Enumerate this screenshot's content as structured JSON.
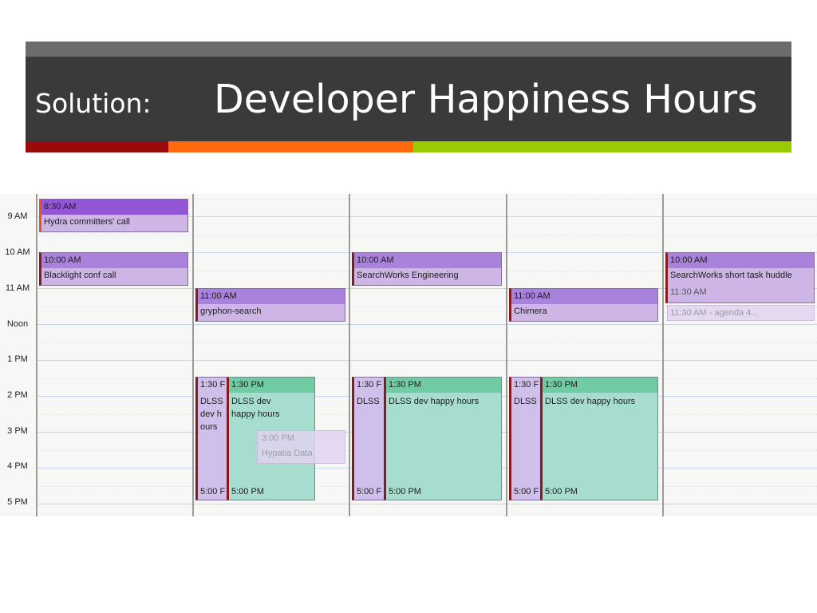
{
  "slide": {
    "prefix": "Solution:",
    "title": "Developer Happiness Hours",
    "stripe_colors": [
      "#9a0a0a",
      "#ff6a0c",
      "#99cc00"
    ]
  },
  "calendar": {
    "time_labels": [
      "9 AM",
      "10 AM",
      "11 AM",
      "Noon",
      "1 PM",
      "2 PM",
      "3 PM",
      "4 PM",
      "5 PM"
    ],
    "events": [
      {
        "start": "8:30 AM",
        "title": "Hydra committers' call"
      },
      {
        "start": "10:00 AM",
        "title": "Blacklight conf call"
      },
      {
        "start": "11:00 AM",
        "title": "gryphon-search"
      },
      {
        "start": "1:30 F",
        "title": "DLSS dev happy hours",
        "end": "5:00 F",
        "short_title": "DLSS dev hours"
      },
      {
        "start": "1:30 PM",
        "title": "DLSS dev happy hours",
        "end": "5:00 PM"
      },
      {
        "start": "3:00 PM",
        "title": "Hypatia Data"
      },
      {
        "start": "10:00 AM",
        "title": "SearchWorks Engineering"
      },
      {
        "start": "1:30 F",
        "title": "DLSS",
        "end": "5:00 F"
      },
      {
        "start": "1:30 PM",
        "title": "DLSS dev happy hours",
        "end": "5:00 PM"
      },
      {
        "start": "11:00 AM",
        "title": "Chimera"
      },
      {
        "start": "1:30 F",
        "title": "DLSS",
        "end": "5:00 F"
      },
      {
        "start": "1:30 PM",
        "title": "DLSS dev happy hours",
        "end": "5:00 PM"
      },
      {
        "start": "10:00 AM",
        "title": "SearchWorks short task huddle",
        "subtime": "11:30 AM"
      },
      {
        "text": "11:30 AM - agenda 4..."
      }
    ]
  }
}
